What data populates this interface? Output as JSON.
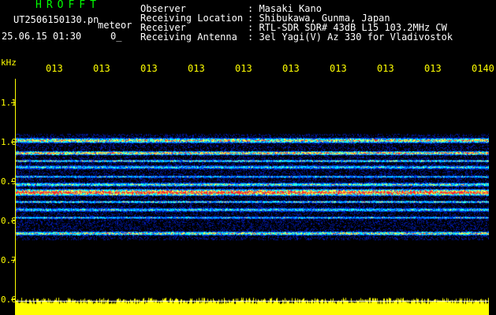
{
  "header": {
    "title": "HROFFT",
    "filename": "UT2506150130.pn",
    "suffix": "meteor",
    "datetime": "25.06.15 01:30",
    "zero": "0_",
    "info": [
      {
        "label": "Observer",
        "value": ": Masaki Kano"
      },
      {
        "label": "Receiving Location",
        "value": ": Shibukawa, Gunma, Japan"
      },
      {
        "label": "Receiver",
        "value": ": RTL-SDR SDR# 43dB L15 103.2MHz CW"
      },
      {
        "label": "Receiving Antenna",
        "value": ": 3el Yagi(V) Az 330 for Vladivostok"
      }
    ]
  },
  "axis": {
    "unit": "kHz",
    "yticks": [
      "1.1",
      "1.0",
      "0.9",
      "0.8",
      "0.7",
      "0.6"
    ],
    "time_labels": [
      "013",
      "013",
      "013",
      "013",
      "013",
      "013",
      "013",
      "013",
      "013",
      "0140"
    ]
  },
  "colors": {
    "background": "#000000",
    "noise": "#0018a8",
    "signal": "#00ffff",
    "peak": "#ff3030",
    "axis": "#ffff00",
    "title": "#00ff00"
  }
}
